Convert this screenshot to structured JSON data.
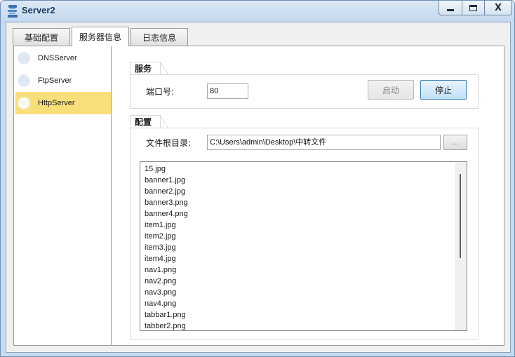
{
  "window": {
    "title": "Server2",
    "controls": {
      "minimize": "minimize",
      "maximize": "maximize",
      "close": "X"
    }
  },
  "tabs": [
    {
      "label": "基础配置",
      "active": false
    },
    {
      "label": "服务器信息",
      "active": true
    },
    {
      "label": "日志信息",
      "active": false
    }
  ],
  "sidebar": {
    "items": [
      {
        "label": "DNSServer",
        "selected": false
      },
      {
        "label": "FtpServer",
        "selected": false
      },
      {
        "label": "HttpServer",
        "selected": true
      }
    ]
  },
  "service": {
    "group_label": "服务",
    "port_label": "端口号:",
    "port_value": "80",
    "start_label": "启动",
    "stop_label": "停止"
  },
  "config": {
    "group_label": "配置",
    "root_label": "文件根目录:",
    "root_value": "C:\\Users\\admin\\Desktop\\中转文件",
    "browse_label": "...",
    "files": [
      "15.jpg",
      "banner1.jpg",
      "banner2.jpg",
      "banner3.png",
      "banner4.png",
      "item1.jpg",
      "item2.jpg",
      "item3.jpg",
      "item4.jpg",
      "nav1.png",
      "nav2.png",
      "nav3.png",
      "nav4.png",
      "tabbar1.png",
      "tabber2.png"
    ]
  },
  "colors": {
    "selected_item": "#f9df7a",
    "hot_button": "#bfe0f7",
    "window_frame": "#c8dcf0"
  },
  "icons": {
    "app": "server-app-icon"
  }
}
